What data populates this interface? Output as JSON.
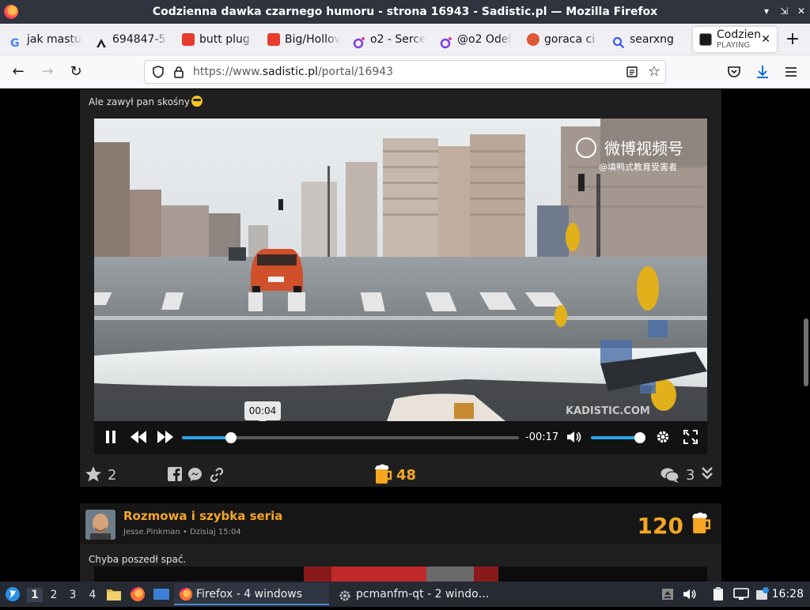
{
  "window": {
    "title": "Codzienna dawka czarnego humoru - strona 16943 - Sadistic.pl — Mozilla Firefox"
  },
  "tabs": [
    {
      "label": "jak mastu",
      "icon": "google-icon"
    },
    {
      "label": "694847-5",
      "icon": "site-icon"
    },
    {
      "label": "butt plug",
      "icon": "shop-icon"
    },
    {
      "label": "Big/Hollov",
      "icon": "shop-icon"
    },
    {
      "label": "o2 - Serce",
      "icon": "o2-icon"
    },
    {
      "label": "@o2 Odel",
      "icon": "o2-icon"
    },
    {
      "label": "goraca ci",
      "icon": "duckduckgo-icon"
    },
    {
      "label": "searxng",
      "icon": "search-icon"
    },
    {
      "label": "Codzien",
      "sub": "PLAYING",
      "active": true
    }
  ],
  "urlbar": {
    "prefix": "https://www.",
    "domain": "sadistic.pl",
    "path": "/portal/16943"
  },
  "post1": {
    "caption": "Ale zawył pan skośny",
    "video": {
      "watermark_main": "微博视频号",
      "watermark_sub": "@填鸭式教育受害者",
      "watermark_site": "KADISTIC.COM",
      "tooltip_time": "00:04",
      "remaining": "-00:17",
      "progress": 0.145,
      "volume": 1.0
    },
    "stars": "2",
    "beers": "48",
    "comments": "3"
  },
  "post2": {
    "title": "Rozmowa i szybka seria",
    "author": "Jesse.Pinkman",
    "date": "Dzisiaj 15:04",
    "score": "120",
    "caption": "Chyba poszedł spać."
  },
  "taskbar": {
    "workspaces": [
      "1",
      "2",
      "3",
      "4"
    ],
    "tasks": [
      {
        "label": "Firefox - 4 windows",
        "active": true
      },
      {
        "label": "pcmanfm-qt - 2 windo…",
        "active": false
      }
    ],
    "clock": "16:28"
  },
  "colors": {
    "accent": "#f5a623",
    "progress": "#28a7e6",
    "titlebar": "#2f343f"
  }
}
